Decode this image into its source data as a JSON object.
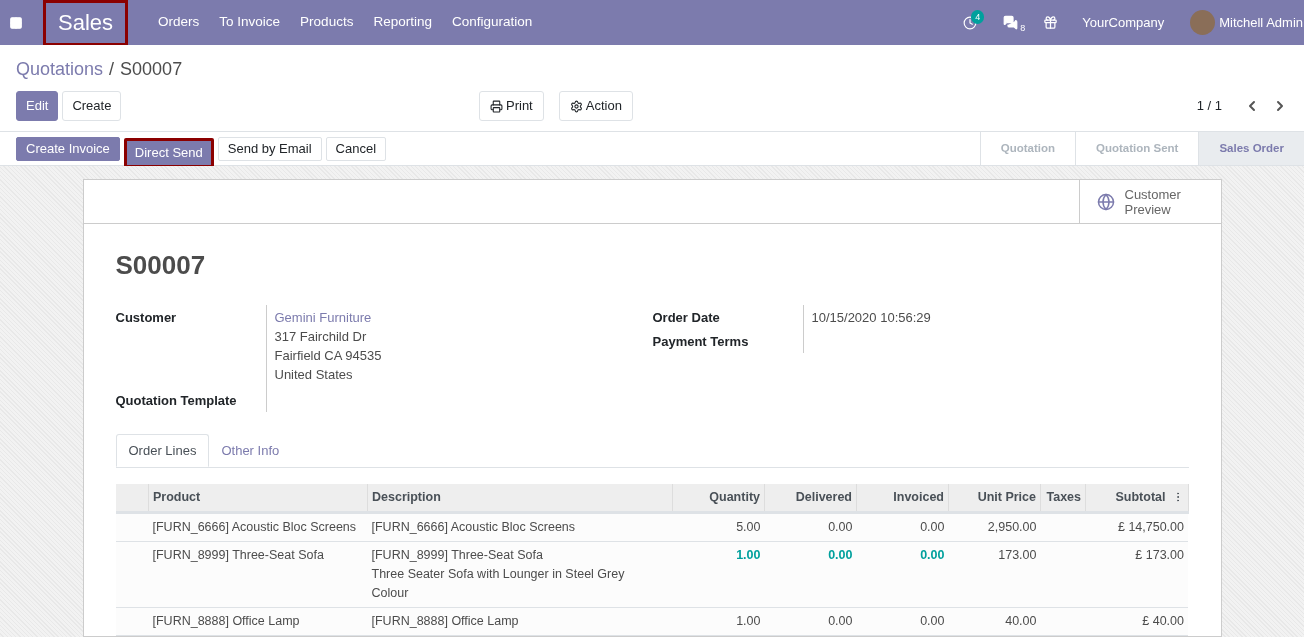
{
  "navbar": {
    "app": {
      "label": "Sales",
      "highlighted": true
    },
    "menu": [
      "Orders",
      "To Invoice",
      "Products",
      "Reporting",
      "Configuration"
    ],
    "activity_count": "4",
    "message_count": "8",
    "company": "YourCompany",
    "user": "Mitchell Admin"
  },
  "breadcrumb": {
    "parent": "Quotations",
    "separator": "/",
    "current": "S00007"
  },
  "toolbar": {
    "left": [
      {
        "label": "Edit",
        "kind": "primary"
      },
      {
        "label": "Create",
        "kind": "default"
      }
    ],
    "center": [
      {
        "label": "Print",
        "kind": "print"
      },
      {
        "label": "Action",
        "kind": "action"
      }
    ],
    "pager": "1 / 1"
  },
  "actions": [
    {
      "label": "Create Invoice",
      "kind": "primary",
      "highlighted": false
    },
    {
      "label": "Direct Send",
      "kind": "primary",
      "highlighted": true
    },
    {
      "label": "Send by Email",
      "kind": "default",
      "highlighted": false
    },
    {
      "label": "Cancel",
      "kind": "default",
      "highlighted": false
    }
  ],
  "stages": [
    {
      "label": "Quotation",
      "selected": false
    },
    {
      "label": "Quotation Sent",
      "selected": false
    },
    {
      "label": "Sales Order",
      "selected": true
    }
  ],
  "preview_button": {
    "line1": "Customer",
    "line2": "Preview"
  },
  "title": "S00007",
  "fields_left": [
    {
      "label": "Customer",
      "link": "Gemini Furniture",
      "lines": [
        "317 Fairchild Dr",
        "Fairfield CA 94535",
        "United States"
      ]
    },
    {
      "label": "Quotation Template"
    }
  ],
  "fields_right": [
    {
      "label": "Order Date",
      "value": "10/15/2020 10:56:29"
    },
    {
      "label": "Payment Terms"
    }
  ],
  "tabs": [
    {
      "label": "Order Lines",
      "selected": true
    },
    {
      "label": "Other Info",
      "selected": false
    }
  ],
  "table": {
    "columns": [
      "Product",
      "Description",
      "Quantity",
      "Delivered",
      "Invoiced",
      "Unit Price",
      "Taxes",
      "Subtotal"
    ],
    "rows": [
      {
        "product": "[FURN_6666] Acoustic Bloc Screens",
        "description": [
          "[FURN_6666] Acoustic Bloc Screens"
        ],
        "quantity": "5.00",
        "delivered": "0.00",
        "invoiced": "0.00",
        "unit_price": "2,950.00",
        "subtotal": "£ 14,750.00",
        "emphasis": false
      },
      {
        "product": "[FURN_8999] Three-Seat Sofa",
        "description": [
          "[FURN_8999] Three-Seat Sofa",
          "Three Seater Sofa with Lounger in Steel Grey Colour"
        ],
        "quantity": "1.00",
        "delivered": "0.00",
        "invoiced": "0.00",
        "unit_price": "173.00",
        "subtotal": "£ 173.00",
        "emphasis": true
      },
      {
        "product": "[FURN_8888] Office Lamp",
        "description": [
          "[FURN_8888] Office Lamp"
        ],
        "quantity": "1.00",
        "delivered": "0.00",
        "invoiced": "0.00",
        "unit_price": "40.00",
        "subtotal": "£ 40.00",
        "emphasis": false
      }
    ]
  }
}
